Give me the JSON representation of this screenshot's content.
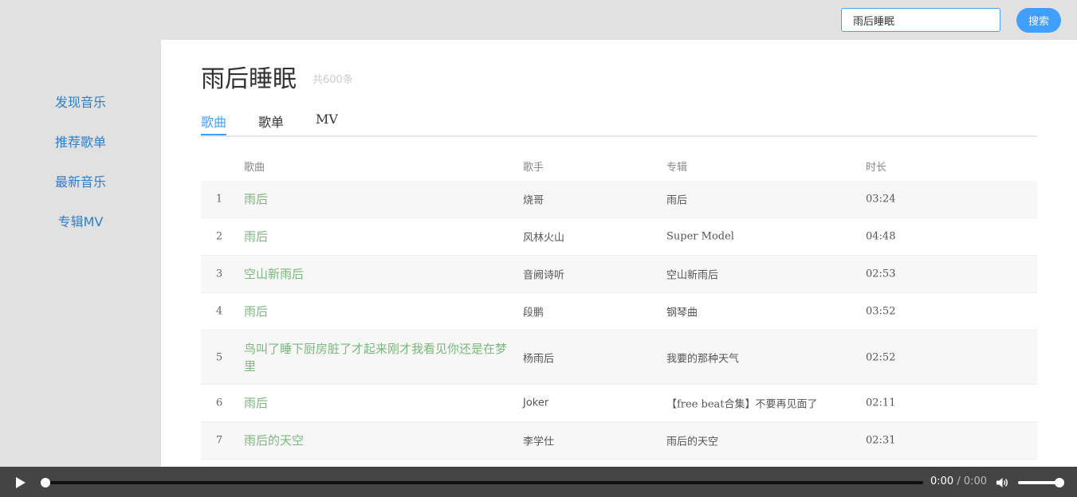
{
  "search": {
    "value": "雨后睡眠",
    "button_label": "搜索"
  },
  "sidebar": {
    "items": [
      {
        "label": "发现音乐"
      },
      {
        "label": "推荐歌单"
      },
      {
        "label": "最新音乐"
      },
      {
        "label": "专辑MV"
      }
    ]
  },
  "main": {
    "title": "雨后睡眠",
    "count": "共600条",
    "tabs": [
      {
        "label": "歌曲",
        "active": true
      },
      {
        "label": "歌单",
        "active": false
      },
      {
        "label": "MV",
        "active": false
      }
    ],
    "table": {
      "headers": {
        "song": "歌曲",
        "artist": "歌手",
        "album": "专辑",
        "duration": "时长"
      },
      "rows": [
        {
          "index": "1",
          "song": "雨后",
          "artist": "烧哥",
          "album": "雨后",
          "duration": "03:24"
        },
        {
          "index": "2",
          "song": "雨后",
          "artist": "风林火山",
          "album": "Super Model",
          "duration": "04:48"
        },
        {
          "index": "3",
          "song": "空山新雨后",
          "artist": "音阙诗听",
          "album": "空山新雨后",
          "duration": "02:53"
        },
        {
          "index": "4",
          "song": "雨后",
          "artist": "段鹏",
          "album": "钢琴曲",
          "duration": "03:52"
        },
        {
          "index": "5",
          "song": "鸟叫了睡下厨房脏了才起来刚才我看见你还是在梦里",
          "artist": "杨雨后",
          "album": "我要的那种天气",
          "duration": "02:52"
        },
        {
          "index": "6",
          "song": "雨后",
          "artist": "Joker",
          "album": "【free beat合集】不要再见面了",
          "duration": "02:11"
        },
        {
          "index": "7",
          "song": "雨后的天空",
          "artist": "李学仕",
          "album": "雨后的天空",
          "duration": "02:31"
        }
      ]
    }
  },
  "player": {
    "current_time": "0:00",
    "separator": "/",
    "total_time": "0:00",
    "progress": 0,
    "volume": 1,
    "play_icon": "play-icon",
    "volume_icon": "volume-icon"
  },
  "colors": {
    "accent": "#409eff",
    "nav_link": "#2f7ec8",
    "song_link": "#7ab87d",
    "player_bg": "#444444"
  }
}
